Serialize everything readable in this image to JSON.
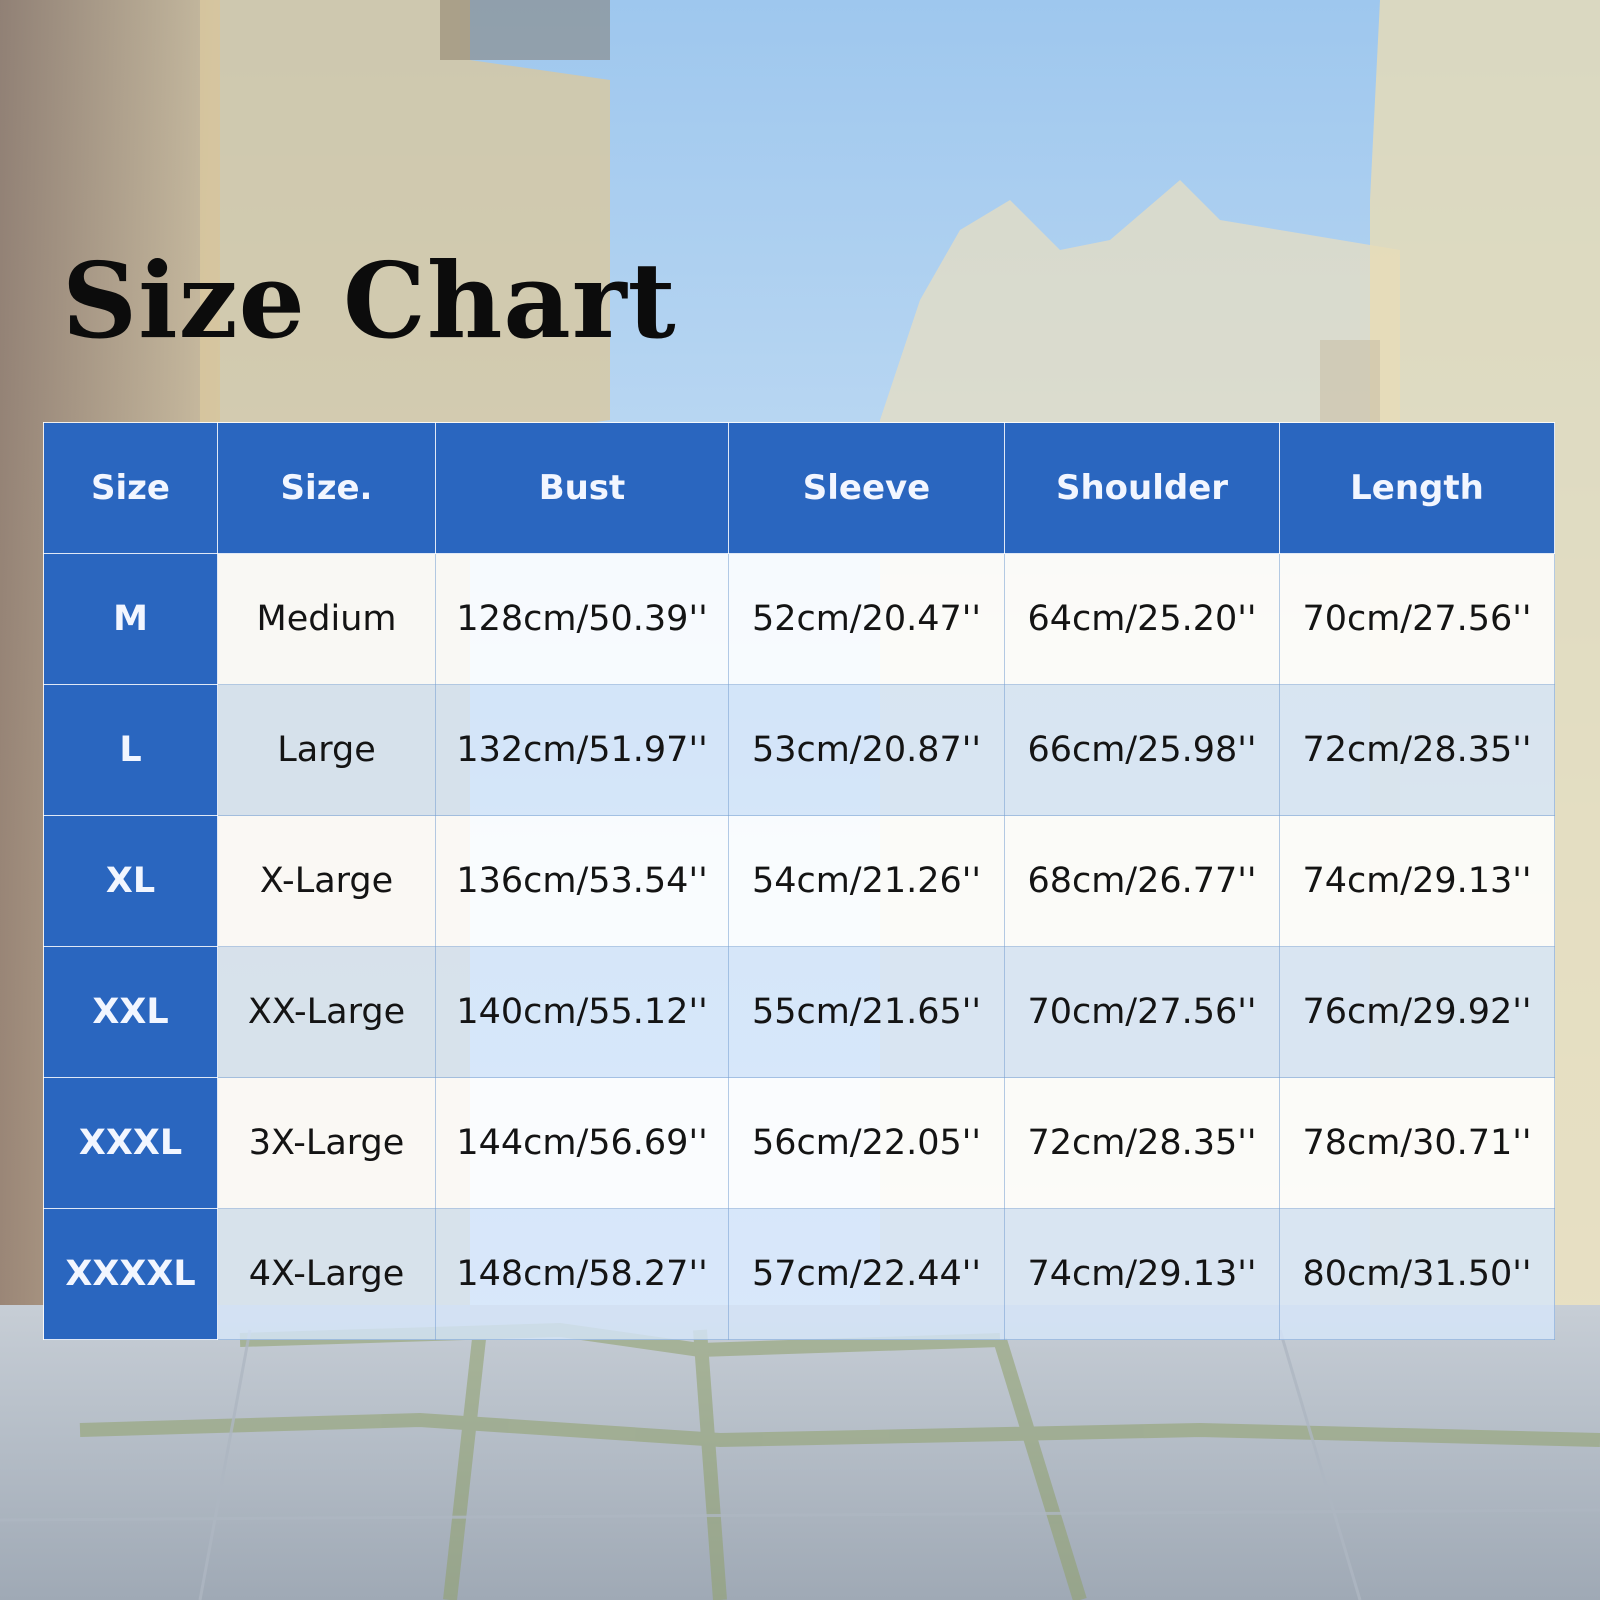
{
  "title": "Size Chart",
  "colors": {
    "header": "#2a66bf",
    "header_text": "#f2f6ff",
    "cell_text": "#141414"
  },
  "columns": [
    "Size",
    "Size.",
    "Bust",
    "Sleeve",
    "Shoulder",
    "Length"
  ],
  "rows": [
    [
      "M",
      "Medium",
      "128cm/50.39''",
      "52cm/20.47''",
      "64cm/25.20''",
      "70cm/27.56''"
    ],
    [
      "L",
      "Large",
      "132cm/51.97''",
      "53cm/20.87''",
      "66cm/25.98''",
      "72cm/28.35''"
    ],
    [
      "XL",
      "X-Large",
      "136cm/53.54''",
      "54cm/21.26''",
      "68cm/26.77''",
      "74cm/29.13''"
    ],
    [
      "XXL",
      "XX-Large",
      "140cm/55.12''",
      "55cm/21.65''",
      "70cm/27.56''",
      "76cm/29.92''"
    ],
    [
      "XXXL",
      "3X-Large",
      "144cm/56.69''",
      "56cm/22.05''",
      "72cm/28.35''",
      "78cm/30.71''"
    ],
    [
      "XXXXL",
      "4X-Large",
      "148cm/58.27''",
      "57cm/22.44''",
      "74cm/29.13''",
      "80cm/31.50''"
    ]
  ]
}
